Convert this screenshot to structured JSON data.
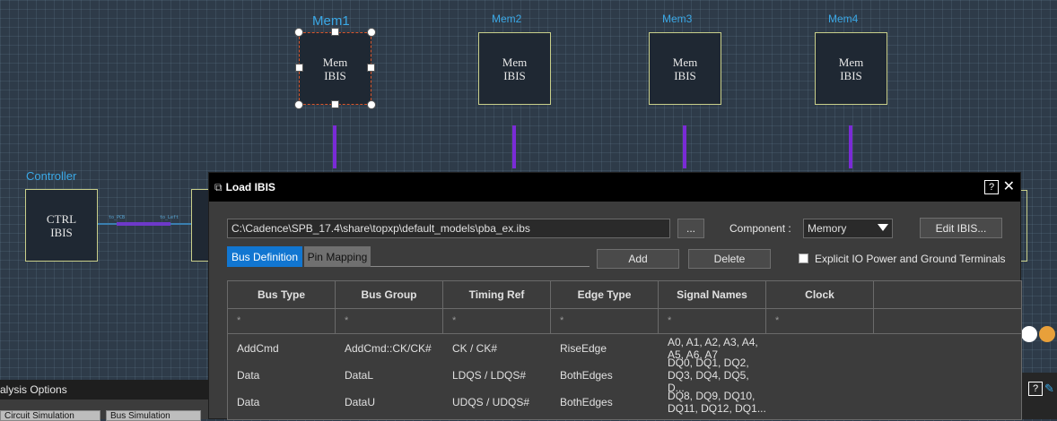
{
  "schematic": {
    "controller": {
      "label": "Controller",
      "line1": "CTRL",
      "line2": "IBIS"
    },
    "memories": [
      {
        "label": "Mem1",
        "line1": "Mem",
        "line2": "IBIS"
      },
      {
        "label": "Mem2",
        "line1": "Mem",
        "line2": "IBIS"
      },
      {
        "label": "Mem3",
        "line1": "Mem",
        "line2": "IBIS"
      },
      {
        "label": "Mem4",
        "line1": "Mem",
        "line2": "IBIS"
      }
    ],
    "wire_labels": {
      "to_pcb": "to_PCB",
      "to_left": "to_Left"
    }
  },
  "dialog": {
    "title": "Load IBIS",
    "help": "?",
    "close": "✕",
    "file_path": "C:\\Cadence\\SPB_17.4\\share\\topxp\\default_models\\pba_ex.ibs",
    "browse_label": "...",
    "component_label": "Component :",
    "component_value": "Memory",
    "edit_ibis_label": "Edit IBIS...",
    "tabs": [
      {
        "label": "Bus Definition"
      },
      {
        "label": "Pin Mapping"
      }
    ],
    "add_label": "Add",
    "delete_label": "Delete",
    "explicit_io_label": "Explicit IO Power and Ground Terminals",
    "table": {
      "headers": [
        "Bus Type",
        "Bus Group",
        "Timing Ref",
        "Edge Type",
        "Signal Names",
        "Clock",
        ""
      ],
      "filter": [
        "*",
        "*",
        "*",
        "*",
        "*",
        "*"
      ],
      "rows": [
        {
          "bus_type": "AddCmd",
          "bus_group": "AddCmd::CK/CK#",
          "timing_ref": "CK / CK#",
          "edge_type": "RiseEdge",
          "signals1": "A0, A1, A2, A3, A4,",
          "signals2": "A5, A6, A7",
          "clock": ""
        },
        {
          "bus_type": "Data",
          "bus_group": "DataL",
          "timing_ref": "LDQS / LDQS#",
          "edge_type": "BothEdges",
          "signals1": "DQ0, DQ1, DQ2,",
          "signals2": "DQ3, DQ4, DQ5, D...",
          "clock": ""
        },
        {
          "bus_type": "Data",
          "bus_group": "DataU",
          "timing_ref": "UDQS / UDQS#",
          "edge_type": "BothEdges",
          "signals1": "DQ8, DQ9, DQ10,",
          "signals2": "DQ11, DQ12, DQ1...",
          "clock": ""
        }
      ]
    }
  },
  "bottom_panel": {
    "title": "alysis Options",
    "tab1": "Circuit Simulation",
    "tab2": "Bus Simulation"
  },
  "right_strip": {
    "help": "?"
  },
  "colors": {
    "accent": "#1176d1",
    "label_blue": "#3aa8e6",
    "wire_purple": "#7a2bd6",
    "selection": "#d9552a"
  }
}
